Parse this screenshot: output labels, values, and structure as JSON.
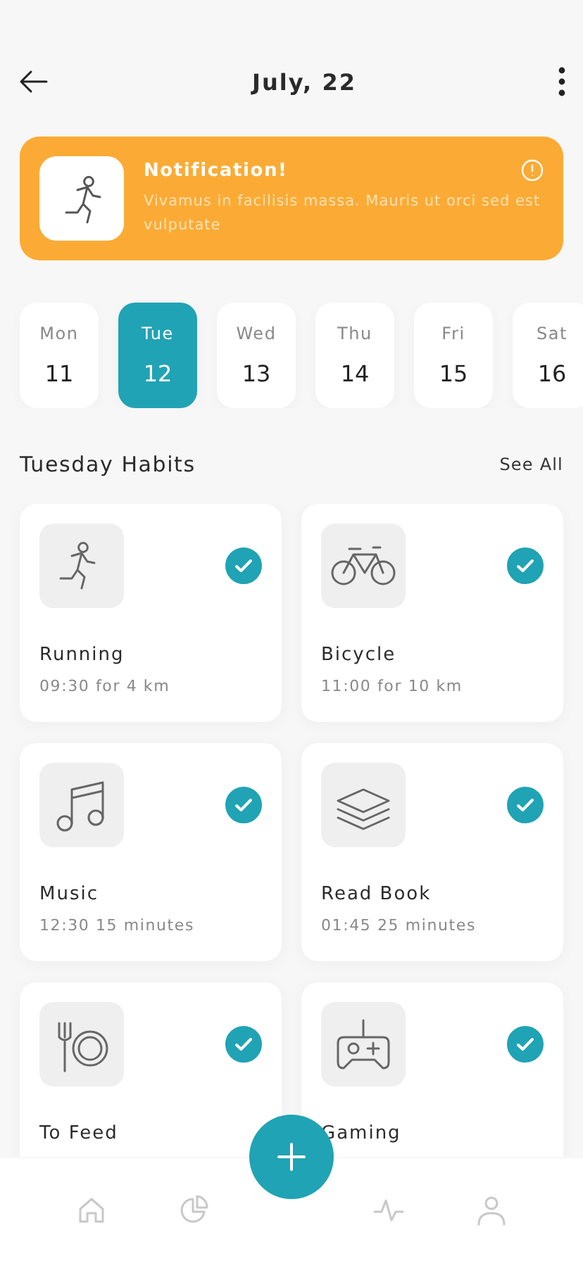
{
  "header": {
    "title": "July, 22"
  },
  "notification": {
    "title": "Notification!",
    "message": "Vivamus in facilisis massa. Mauris ut orci sed est vulputate"
  },
  "days": [
    {
      "weekday": "Mon",
      "date": "11",
      "selected": false
    },
    {
      "weekday": "Tue",
      "date": "12",
      "selected": true
    },
    {
      "weekday": "Wed",
      "date": "13",
      "selected": false
    },
    {
      "weekday": "Thu",
      "date": "14",
      "selected": false
    },
    {
      "weekday": "Fri",
      "date": "15",
      "selected": false
    },
    {
      "weekday": "Sat",
      "date": "16",
      "selected": false
    }
  ],
  "section": {
    "title": "Tuesday Habits",
    "link": "See All"
  },
  "habits": [
    {
      "kind": "running",
      "name": "Running",
      "detail": "09:30 for 4 km",
      "checked": true
    },
    {
      "kind": "bicycle",
      "name": "Bicycle",
      "detail": "11:00 for 10 km",
      "checked": true
    },
    {
      "kind": "music",
      "name": "Music",
      "detail": "12:30 15 minutes",
      "checked": true
    },
    {
      "kind": "book",
      "name": "Read Book",
      "detail": "01:45 25 minutes",
      "checked": true
    },
    {
      "kind": "food",
      "name": "To Feed",
      "checked": true
    },
    {
      "kind": "gaming",
      "name": "Gaming",
      "checked": true
    }
  ],
  "nav": [
    {
      "kind": "home"
    },
    {
      "kind": "chart"
    },
    {
      "kind": "add"
    },
    {
      "kind": "activity"
    },
    {
      "kind": "profile"
    }
  ]
}
